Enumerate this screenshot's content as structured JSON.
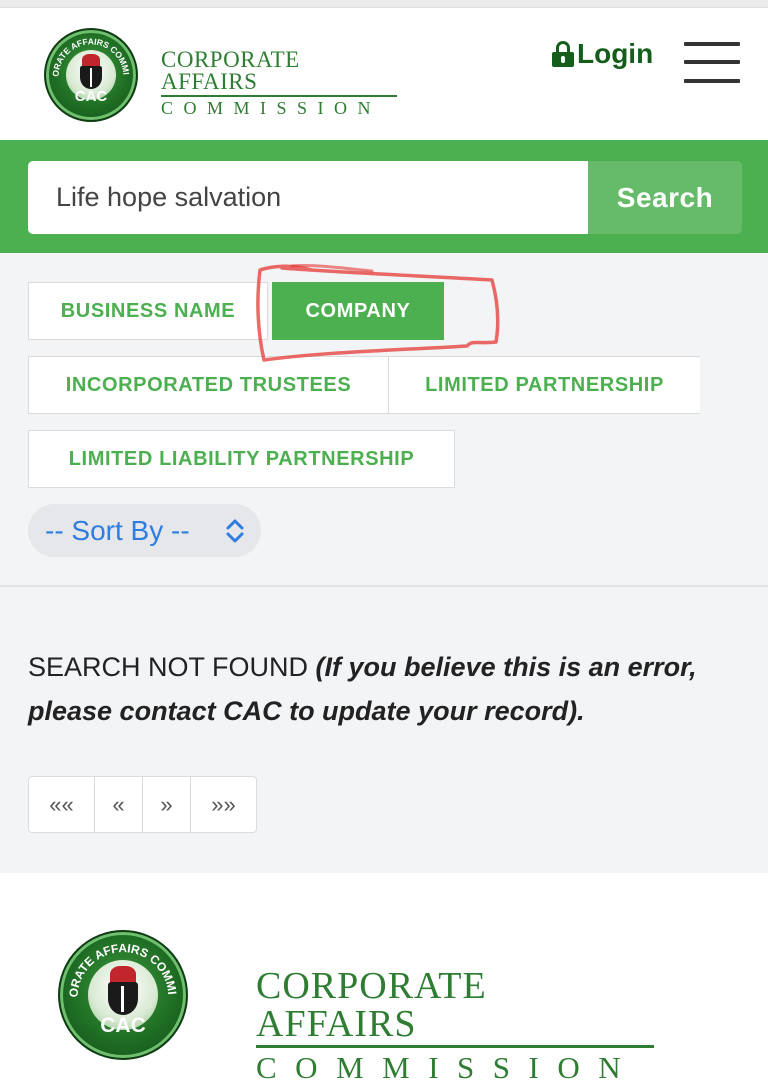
{
  "header": {
    "logo_ring_text": "CORPORATE AFFAIRS COMMISSION",
    "logo_badge": "CAC",
    "brand_line1": "CORPORATE AFFAIRS",
    "brand_line2": "COMMISSION",
    "login_label": "Login"
  },
  "search": {
    "value": "Life hope salvation",
    "button_label": "Search"
  },
  "filters": {
    "tabs": [
      {
        "label": "BUSINESS NAME",
        "active": false
      },
      {
        "label": "COMPANY",
        "active": true
      },
      {
        "label": "INCORPORATED TRUSTEES",
        "active": false
      },
      {
        "label": "LIMITED PARTNERSHIP",
        "active": false
      },
      {
        "label": "LIMITED LIABILITY PARTNERSHIP",
        "active": false
      }
    ],
    "sort_label": "-- Sort By --"
  },
  "results": {
    "message": "SEARCH NOT FOUND",
    "note": "(If you believe this is an error, please contact CAC to update your record)."
  },
  "pagination": {
    "first": "««",
    "prev": "«",
    "next": "»",
    "last": "»»"
  },
  "footer": {
    "logo_ring_text": "CORPORATE AFFAIRS COMMISSION",
    "logo_badge": "CAC",
    "brand_line1": "CORPORATE AFFAIRS",
    "brand_line2": "COMMISSION"
  },
  "colors": {
    "primary_green": "#4caf50",
    "dark_green": "#155d1a",
    "brand_green": "#2e7d32",
    "annotation_red": "#e53935",
    "link_blue": "#2f7de1"
  }
}
